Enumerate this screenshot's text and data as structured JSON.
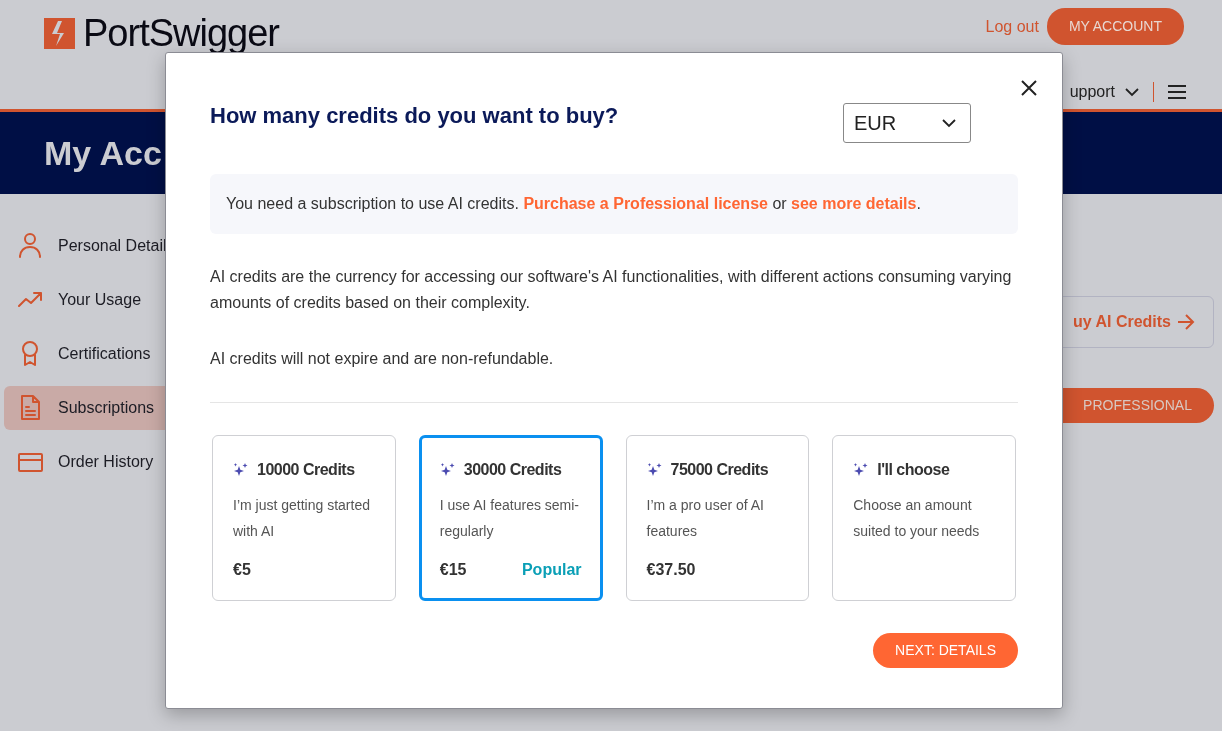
{
  "header": {
    "logo": "PortSwigger",
    "logout": "Log out",
    "account_button": "MY ACCOUNT",
    "nav_item": "upport"
  },
  "banner": {
    "title": "My Acc"
  },
  "sidebar": {
    "items": [
      {
        "label": "Personal Detail",
        "selected": false
      },
      {
        "label": "Your Usage",
        "selected": false
      },
      {
        "label": "Certifications",
        "selected": false
      },
      {
        "label": "Subscriptions",
        "selected": true
      },
      {
        "label": "Order History",
        "selected": false
      }
    ]
  },
  "side_actions": {
    "credits_button": "uy AI Credits",
    "professional_button": "PROFESSIONAL"
  },
  "modal": {
    "title": "How many credits do you want to buy?",
    "currency": "EUR",
    "notice": [
      {
        "kind": "text",
        "text": "You need a subscription to use AI credits. "
      },
      {
        "kind": "link",
        "text": "Purchase a Professional license"
      },
      {
        "kind": "text",
        "text": " or "
      },
      {
        "kind": "link",
        "text": "see more details"
      },
      {
        "kind": "text",
        "text": "."
      }
    ],
    "paragraphs": [
      "AI credits are the currency for accessing our software's AI functionalities, with different actions consuming varying amounts of credits based on their complexity.",
      "AI credits will not expire and are non-refundable."
    ],
    "options": [
      {
        "title": "10000 Credits",
        "description": "I’m just getting started with AI",
        "price": "€5",
        "selected": false
      },
      {
        "title": "30000 Credits",
        "description": "I use AI features semi-regularly",
        "price": "€15",
        "badge": "Popular",
        "selected": true
      },
      {
        "title": "75000 Credits",
        "description": "I’m a pro user of AI features",
        "price": "€37.50",
        "selected": false
      },
      {
        "title": "I'll choose",
        "description": "Choose an amount suited to your needs",
        "selected": false
      }
    ],
    "next_button": "NEXT: DETAILS"
  }
}
